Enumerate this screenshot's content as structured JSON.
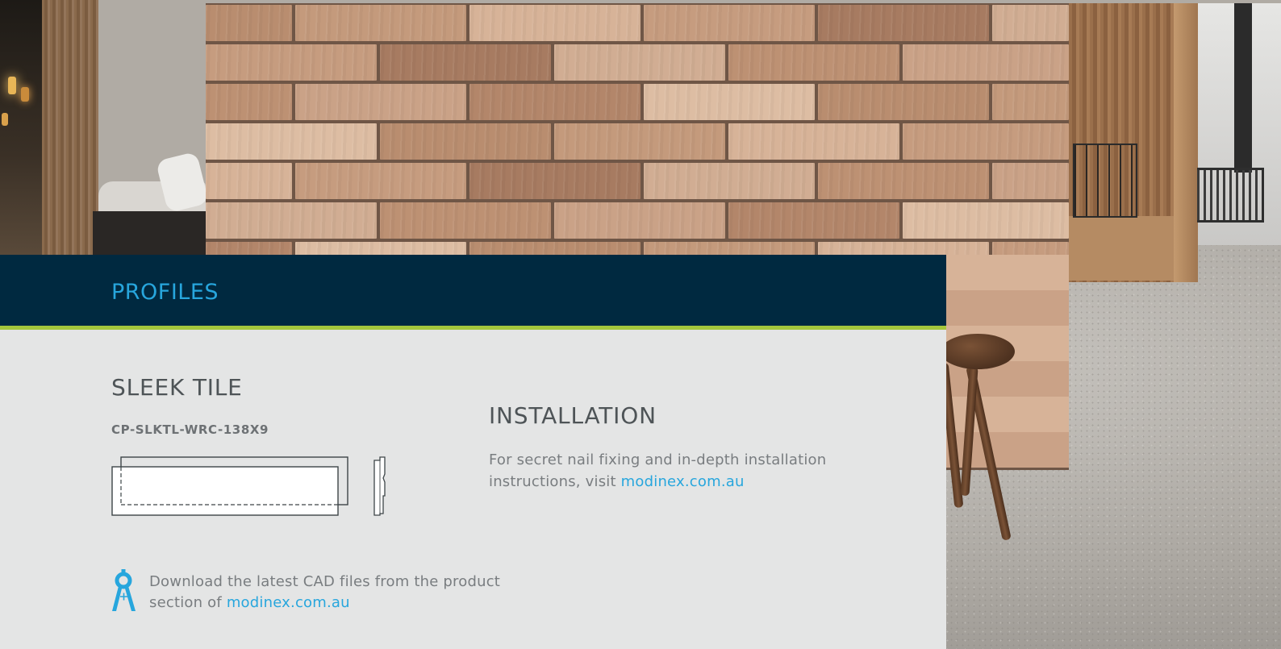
{
  "header": {
    "title": "PROFILES"
  },
  "product": {
    "name": "SLEEK TILE",
    "code": "CP-SLKTL-WRC-138X9"
  },
  "installation": {
    "title": "INSTALLATION",
    "text": "For secret nail fixing and in-depth installation instructions, visit",
    "link_text": "modinex.com.au"
  },
  "cad": {
    "text": "Download the latest CAD files from the product section of",
    "link_text": "modinex.com.au",
    "icon": "compass-icon"
  },
  "colors": {
    "header_bg": "#002940",
    "accent_blue": "#27a6dd",
    "accent_green": "#a4c63c",
    "card_bg": "#e4e5e5"
  }
}
